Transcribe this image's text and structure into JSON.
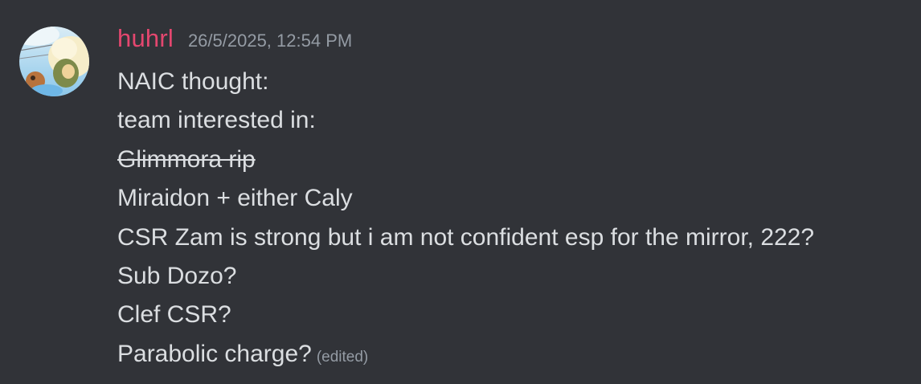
{
  "message": {
    "author": "huhrl",
    "timestamp": "26/5/2025, 12:54 PM",
    "lines": [
      {
        "text": "NAIC thought:",
        "strike": false
      },
      {
        "text": "team interested in:",
        "strike": false
      },
      {
        "text": "Glimmora rip",
        "strike": true
      },
      {
        "text": "Miraidon + either Caly",
        "strike": false
      },
      {
        "text": "CSR Zam is strong but i am not confident esp for the mirror, 222?",
        "strike": false
      },
      {
        "text": "Sub Dozo?",
        "strike": false
      },
      {
        "text": "Clef CSR?",
        "strike": false
      },
      {
        "text": "Parabolic charge?",
        "strike": false
      }
    ],
    "edited_label": "(edited)"
  },
  "colors": {
    "background": "#313338",
    "username": "#e4476f",
    "text": "#dbdee1",
    "muted": "#949ba4"
  },
  "avatar": {
    "icon": "user-avatar-image"
  }
}
